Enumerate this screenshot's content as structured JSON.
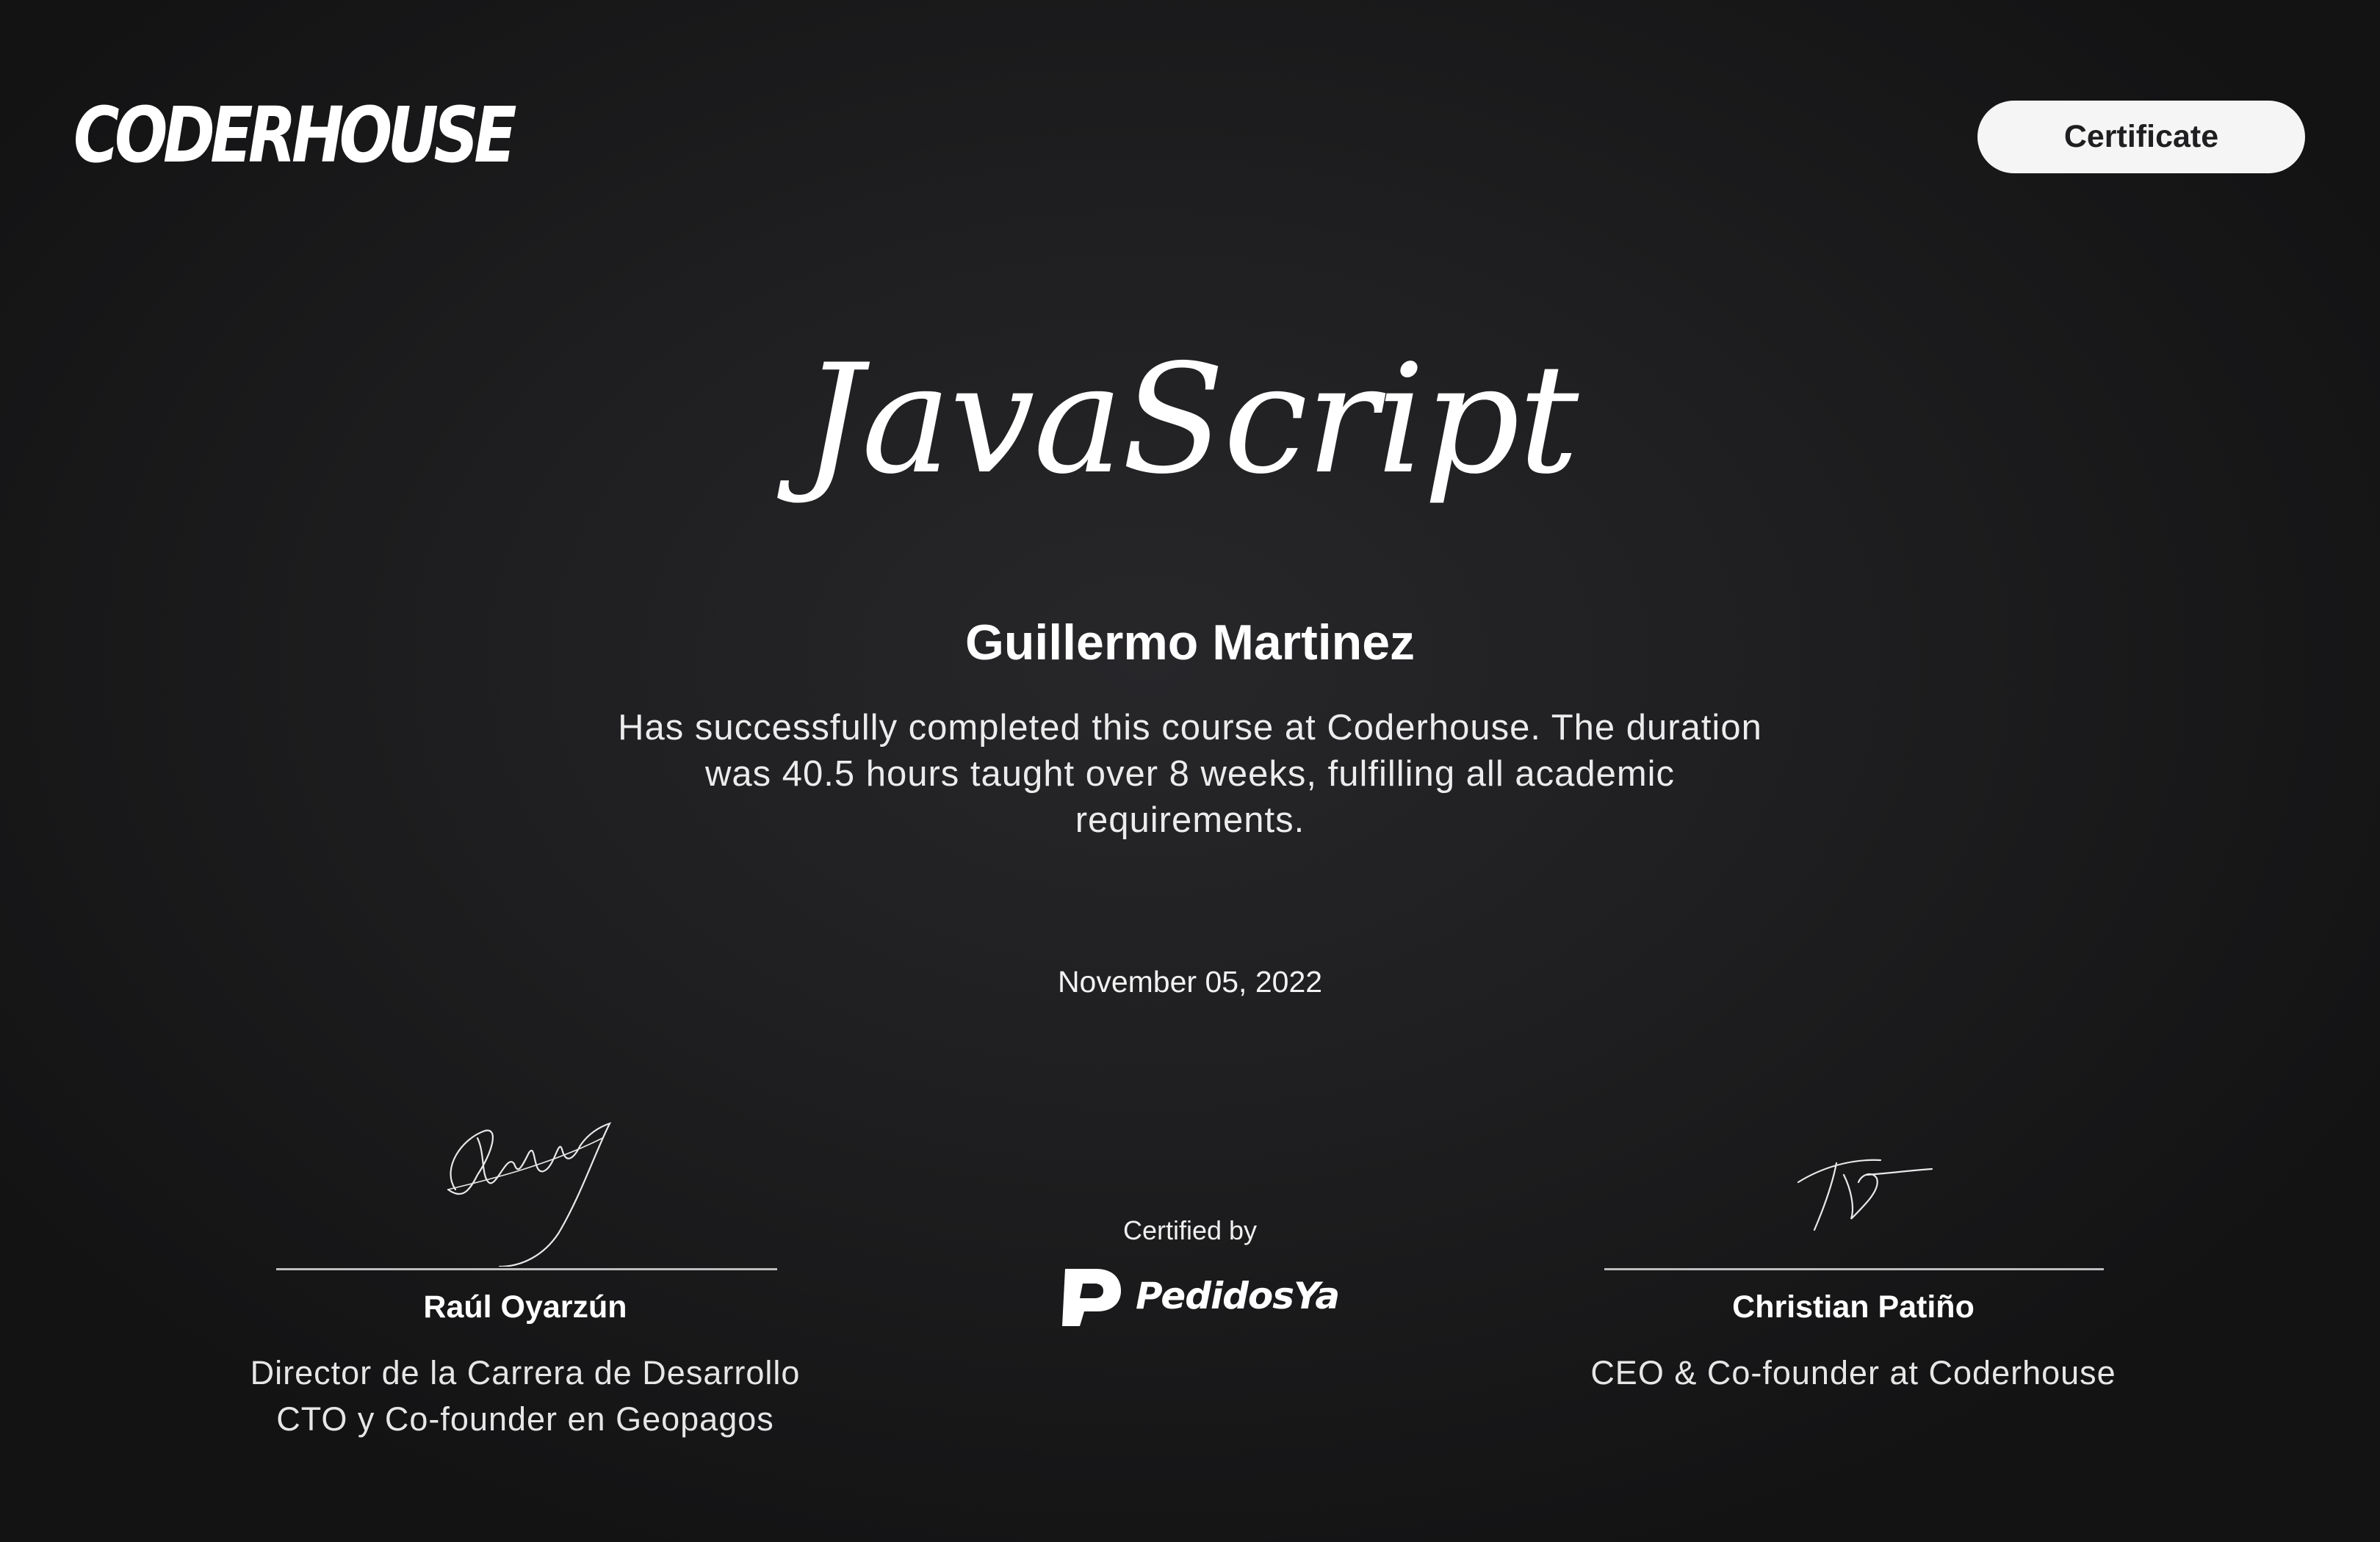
{
  "header": {
    "logo_text": "CODERHOUSE",
    "badge_label": "Certificate"
  },
  "certificate": {
    "course": "JavaScript",
    "student": "Guillermo Martinez",
    "description": "Has successfully completed this course at Coderhouse. The duration was 40.5 hours taught over 8 weeks, fulfilling all academic requirements.",
    "date": "November 05, 2022"
  },
  "signers": [
    {
      "name": "Raúl Oyarzún",
      "role_line1": "Director de la Carrera de Desarrollo",
      "role_line2": "CTO y Co-founder en Geopagos"
    },
    {
      "name": "Christian Patiño",
      "role_line1": "CEO & Co-founder at Coderhouse"
    }
  ],
  "sponsor": {
    "label": "Certified by",
    "name": "PedidosYa"
  }
}
